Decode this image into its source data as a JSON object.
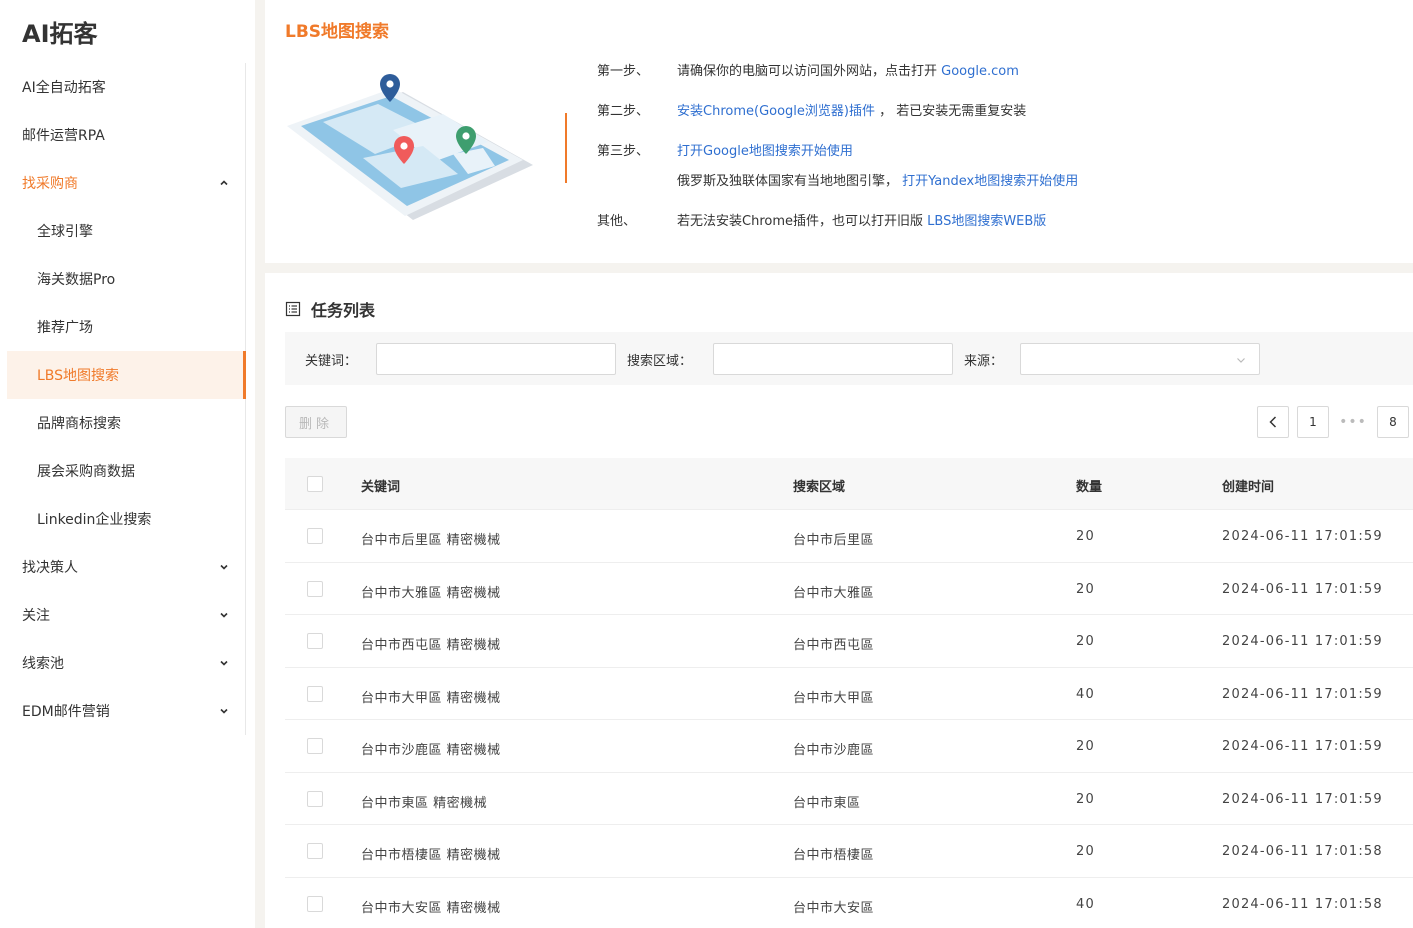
{
  "brand": "AI拓客",
  "sidebar": {
    "items": [
      {
        "label": "AI全自动拓客"
      },
      {
        "label": "邮件运营RPA"
      },
      {
        "label": "找采购商"
      },
      {
        "label": "全球引擎"
      },
      {
        "label": "海关数据Pro"
      },
      {
        "label": "推荐广场"
      },
      {
        "label": "LBS地图搜索"
      },
      {
        "label": "品牌商标搜索"
      },
      {
        "label": "展会采购商数据"
      },
      {
        "label": "Linkedin企业搜索"
      },
      {
        "label": "找决策人"
      },
      {
        "label": "关注"
      },
      {
        "label": "线索池"
      },
      {
        "label": "EDM邮件营销"
      }
    ]
  },
  "header": {
    "title": "LBS地图搜索"
  },
  "steps": {
    "s1_label": "第一步、",
    "s1_text": "请确保你的电脑可以访问国外网站，点击打开",
    "s1_link": "Google.com",
    "s2_label": "第二步、",
    "s2_link": "安装Chrome(Google浏览器)插件",
    "s2_text": "， 若已安装无需重复安装",
    "s3_label": "第三步、",
    "s3_link": "打开Google地图搜索开始使用",
    "s3b_text": "俄罗斯及独联体国家有当地地图引擎，",
    "s3b_link": "打开Yandex地图搜索开始使用",
    "s4_label": "其他、",
    "s4_text": "若无法安装Chrome插件，也可以打开旧版",
    "s4_link": "LBS地图搜索WEB版"
  },
  "task_list": {
    "title": "任务列表",
    "filters": {
      "keyword_label": "关键词：",
      "area_label": "搜索区域：",
      "source_label": "来源："
    },
    "delete_label": "删除",
    "pager": {
      "current": "1",
      "last": "8",
      "ellipsis": "•••"
    },
    "columns": [
      "关键词",
      "搜索区域",
      "数量",
      "创建时间"
    ],
    "rows": [
      {
        "keyword": "台中市后里區 精密機械",
        "area": "台中市后里區",
        "count": "20",
        "time": "2024-06-11 17:01:59"
      },
      {
        "keyword": "台中市大雅區 精密機械",
        "area": "台中市大雅區",
        "count": "20",
        "time": "2024-06-11 17:01:59"
      },
      {
        "keyword": "台中市西屯區 精密機械",
        "area": "台中市西屯區",
        "count": "20",
        "time": "2024-06-11 17:01:59"
      },
      {
        "keyword": "台中市大甲區 精密機械",
        "area": "台中市大甲區",
        "count": "40",
        "time": "2024-06-11 17:01:59"
      },
      {
        "keyword": "台中市沙鹿區 精密機械",
        "area": "台中市沙鹿區",
        "count": "20",
        "time": "2024-06-11 17:01:59"
      },
      {
        "keyword": "台中市東區 精密機械",
        "area": "台中市東區",
        "count": "20",
        "time": "2024-06-11 17:01:59"
      },
      {
        "keyword": "台中市梧棲區 精密機械",
        "area": "台中市梧棲區",
        "count": "20",
        "time": "2024-06-11 17:01:58"
      },
      {
        "keyword": "台中市大安區 精密機械",
        "area": "台中市大安區",
        "count": "40",
        "time": "2024-06-11 17:01:58"
      }
    ]
  },
  "colors": {
    "accent": "#f07a2a",
    "link": "#2f6fd0"
  }
}
